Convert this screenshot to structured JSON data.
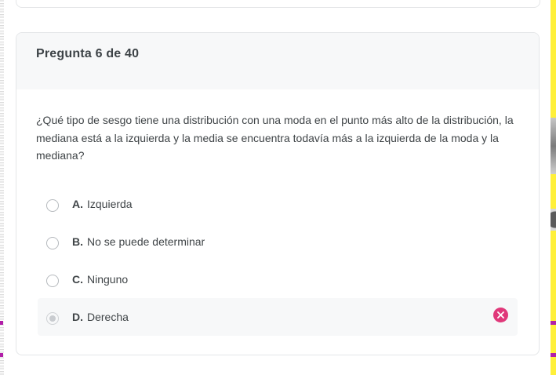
{
  "question": {
    "header": "Pregunta 6 de 40",
    "text": "¿Qué tipo de sesgo tiene una distribución con una moda en el punto más alto de la distribución, la mediana está a la izquierda y la media se encuentra todavía más a la izquierda de la moda y la mediana?",
    "options": [
      {
        "letter": "A.",
        "text": "Izquierda",
        "selected": false
      },
      {
        "letter": "B.",
        "text": "No se puede determinar",
        "selected": false
      },
      {
        "letter": "C.",
        "text": "Ninguno",
        "selected": false
      },
      {
        "letter": "D.",
        "text": "Derecha",
        "selected": true,
        "status": "incorrect"
      }
    ]
  },
  "colors": {
    "incorrect": "#e0387a",
    "header_bg": "#f7f8f9",
    "border": "#e4e6e8"
  },
  "icons": {
    "incorrect": "x-circle-icon",
    "radio": "radio-button"
  }
}
